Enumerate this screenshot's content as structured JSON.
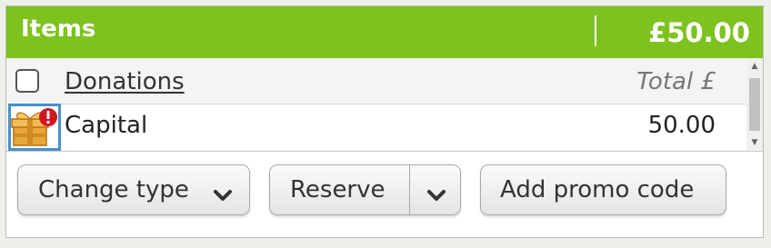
{
  "header": {
    "title": "Items",
    "total": "£50.00",
    "accent_color": "#7ec21f"
  },
  "grid": {
    "columns": {
      "name": "Donations",
      "total": "Total £"
    },
    "rows": [
      {
        "icon": "gift-warning-icon",
        "name": "Capital",
        "value": "50.00"
      }
    ]
  },
  "actions": {
    "change_type": "Change type",
    "reserve": "Reserve",
    "add_promo": "Add promo code"
  }
}
